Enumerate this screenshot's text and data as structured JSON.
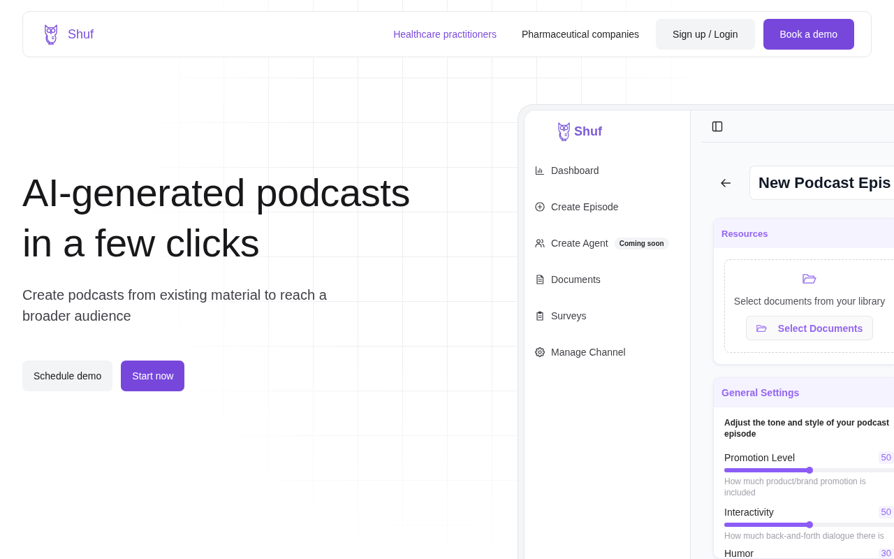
{
  "nav": {
    "brand": "Shuf",
    "links": [
      {
        "label": "Healthcare practitioners",
        "selected": true
      },
      {
        "label": "Pharmaceutical companies",
        "selected": false
      }
    ],
    "buttons": [
      {
        "label": "Sign up / Login",
        "kind": "secondary"
      },
      {
        "label": "Book a demo",
        "kind": "primary"
      }
    ]
  },
  "hero": {
    "heading": "AI-generated podcasts in a few clicks",
    "subtitle": "Create podcasts from existing material to reach a broader audience",
    "buttons": [
      {
        "label": "Schedule demo",
        "kind": "secondary"
      },
      {
        "label": "Start now",
        "kind": "primary"
      }
    ]
  },
  "app_preview": {
    "sidebar": {
      "brand": "Shuf",
      "items": [
        {
          "label": "Dashboard",
          "selected": false
        },
        {
          "label": "Create Episode",
          "selected": false
        },
        {
          "label": "Create Agent",
          "badge": "Coming soon",
          "selected": false
        },
        {
          "label": "Documents",
          "selected": false
        },
        {
          "label": "Surveys",
          "selected": false
        },
        {
          "label": "Manage Channel",
          "selected": false
        }
      ]
    },
    "title_field": {
      "value": "New Podcast Epis"
    },
    "resources": {
      "title": "Resources",
      "empty_text": "Select documents from your library",
      "button": "Select Documents"
    },
    "general_settings": {
      "title": "General Settings",
      "description": "Adjust the tone and style of your podcast episode",
      "sliders": [
        {
          "label": "Promotion Level",
          "value": "50",
          "level": 0.5,
          "hint": "How much product/brand promotion is included"
        },
        {
          "label": "Interactivity",
          "value": "50",
          "level": 0.5,
          "hint": "How much back-and-forth dialogue there is"
        },
        {
          "label": "Humor",
          "value": "30"
        }
      ]
    }
  }
}
